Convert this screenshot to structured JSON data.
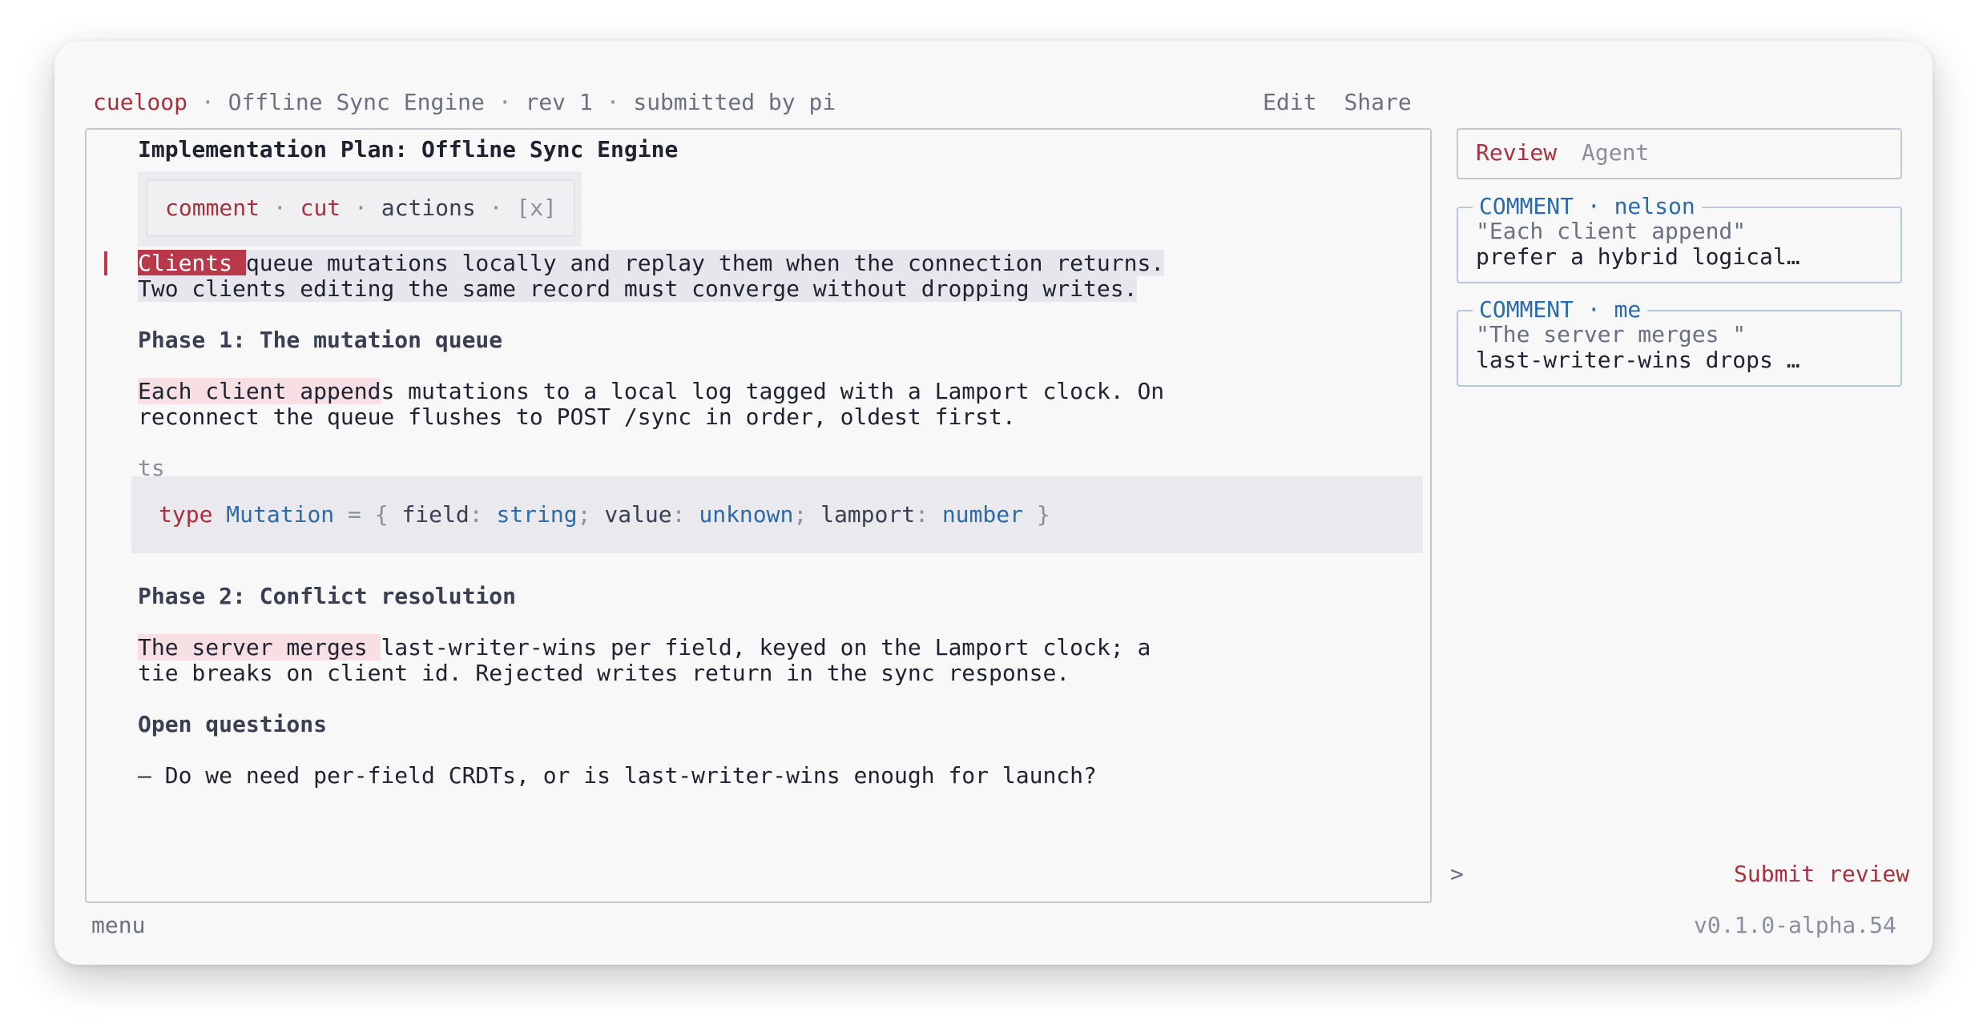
{
  "topbar": {
    "brand": "cueloop",
    "sep": " · ",
    "doc_title": "Offline Sync Engine",
    "rev": "rev 1",
    "submitted": "submitted by pi",
    "edit_label": "Edit",
    "share_label": "Share"
  },
  "doc": {
    "title": "Implementation Plan: Offline Sync Engine",
    "popup": {
      "comment": "comment",
      "cut": "cut",
      "actions": "actions",
      "close": "[x]",
      "dot": " · "
    },
    "para1_sel": "Clients ",
    "para1_rest": "queue mutations locally and replay them when the connection returns.",
    "para1_line2": "Two clients editing the same record must converge without dropping writes.",
    "phase1": "Phase 1: The mutation queue",
    "para2_hl": "Each client append",
    "para2_rest": "s mutations to a local log tagged with a Lamport clock. On",
    "para2_line2": "reconnect the queue flushes to POST /sync in order, oldest first.",
    "code_lang": "ts",
    "code": {
      "kw_type": "type",
      "name": "Mutation",
      "eq_open": " = { ",
      "field_key": "field",
      "colon": ": ",
      "field_type": "string",
      "semi": "; ",
      "value_key": "value",
      "value_type": "unknown",
      "lamport_key": "lamport",
      "lamport_type": "number",
      "close": " }"
    },
    "phase2": "Phase 2: Conflict resolution",
    "para3_hl": "The server merges ",
    "para3_rest": "last-writer-wins per field, keyed on the Lamport clock; a",
    "para3_line2": "tie breaks on client id. Rejected writes return in the sync response.",
    "open_q": "Open questions",
    "question1": "— Do we need per-field CRDTs, or is last-writer-wins enough for launch?"
  },
  "sidebar": {
    "tabs": [
      {
        "label": "Review",
        "active": true
      },
      {
        "label": "Agent",
        "active": false
      }
    ],
    "comments": [
      {
        "legend": "COMMENT · nelson",
        "quote": "\"Each client append\"",
        "body": "prefer a hybrid logical…"
      },
      {
        "legend": "COMMENT · me",
        "quote": "\"The server merges \"",
        "body": "last-writer-wins drops …"
      }
    ],
    "prompt": ">",
    "submit_label": "Submit review"
  },
  "footer": {
    "menu_label": "menu",
    "version": "v0.1.0-alpha.54"
  },
  "colors": {
    "accent": "#a8303c",
    "link_blue": "#2d6aa8",
    "selection": "#b9384a",
    "highlight": "#f7dfe3"
  }
}
